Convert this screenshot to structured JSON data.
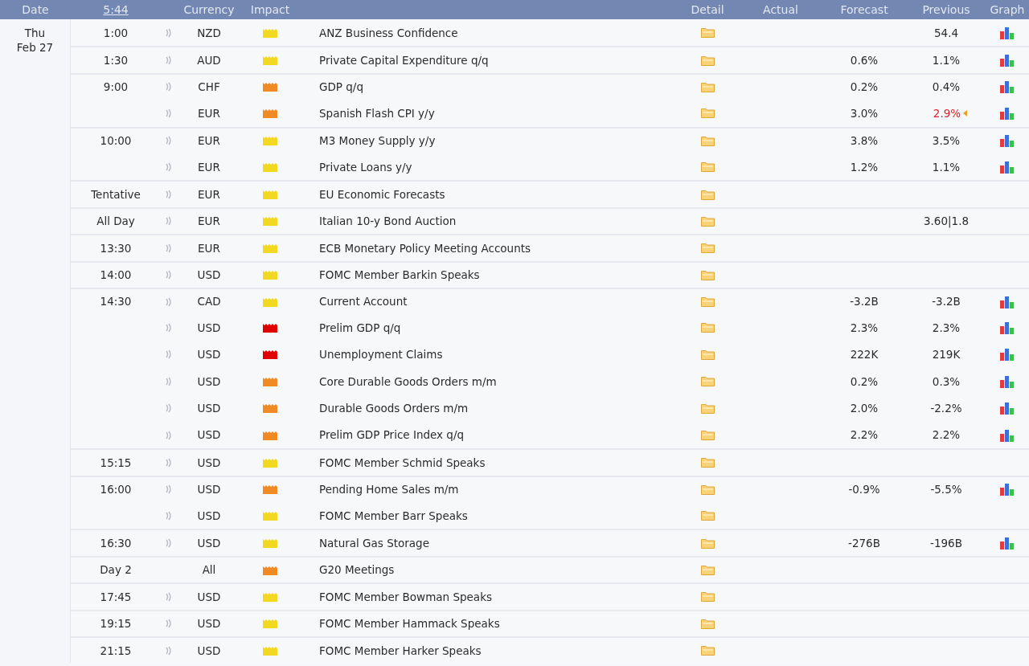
{
  "header": {
    "date": "Date",
    "time": "5:44",
    "currency": "Currency",
    "impact": "Impact",
    "detail": "Detail",
    "actual": "Actual",
    "forecast": "Forecast",
    "previous": "Previous",
    "graph": "Graph"
  },
  "day": {
    "weekday": "Thu",
    "date": "Feb 27"
  },
  "groups": [
    {
      "time": "1:00",
      "rows": [
        {
          "sound": true,
          "currency": "NZD",
          "color": "#f2d820",
          "event": "ANZ Business Confidence",
          "forecast": "",
          "previous": "54.4",
          "revised": false,
          "graph": true
        }
      ]
    },
    {
      "time": "1:30",
      "rows": [
        {
          "sound": true,
          "currency": "AUD",
          "color": "#f2d820",
          "event": "Private Capital Expenditure q/q",
          "forecast": "0.6%",
          "previous": "1.1%",
          "revised": false,
          "graph": true
        }
      ]
    },
    {
      "time": "9:00",
      "rows": [
        {
          "sound": true,
          "currency": "CHF",
          "color": "#f08a24",
          "event": "GDP q/q",
          "forecast": "0.2%",
          "previous": "0.4%",
          "revised": false,
          "graph": true
        },
        {
          "sound": true,
          "currency": "EUR",
          "color": "#f08a24",
          "event": "Spanish Flash CPI y/y",
          "forecast": "3.0%",
          "previous": "2.9%",
          "revised": true,
          "graph": true
        }
      ]
    },
    {
      "time": "10:00",
      "rows": [
        {
          "sound": true,
          "currency": "EUR",
          "color": "#f2d820",
          "event": "M3 Money Supply y/y",
          "forecast": "3.8%",
          "previous": "3.5%",
          "revised": false,
          "graph": true
        },
        {
          "sound": true,
          "currency": "EUR",
          "color": "#f2d820",
          "event": "Private Loans y/y",
          "forecast": "1.2%",
          "previous": "1.1%",
          "revised": false,
          "graph": true
        }
      ]
    },
    {
      "time": "Tentative",
      "rows": [
        {
          "sound": true,
          "currency": "EUR",
          "color": "#f2d820",
          "event": "EU Economic Forecasts",
          "forecast": "",
          "previous": "",
          "revised": false,
          "graph": false
        }
      ]
    },
    {
      "time": "All Day",
      "rows": [
        {
          "sound": true,
          "currency": "EUR",
          "color": "#f2d820",
          "event": "Italian 10-y Bond Auction",
          "forecast": "",
          "previous": "3.60|1.8",
          "revised": false,
          "graph": false
        }
      ]
    },
    {
      "time": "13:30",
      "rows": [
        {
          "sound": true,
          "currency": "EUR",
          "color": "#f2d820",
          "event": "ECB Monetary Policy Meeting Accounts",
          "forecast": "",
          "previous": "",
          "revised": false,
          "graph": false
        }
      ]
    },
    {
      "time": "14:00",
      "rows": [
        {
          "sound": true,
          "currency": "USD",
          "color": "#f2d820",
          "event": "FOMC Member Barkin Speaks",
          "forecast": "",
          "previous": "",
          "revised": false,
          "graph": false
        }
      ]
    },
    {
      "time": "14:30",
      "rows": [
        {
          "sound": true,
          "currency": "CAD",
          "color": "#f2d820",
          "event": "Current Account",
          "forecast": "-3.2B",
          "previous": "-3.2B",
          "revised": false,
          "graph": true
        },
        {
          "sound": true,
          "currency": "USD",
          "color": "#e00000",
          "event": "Prelim GDP q/q",
          "forecast": "2.3%",
          "previous": "2.3%",
          "revised": false,
          "graph": true
        },
        {
          "sound": true,
          "currency": "USD",
          "color": "#e00000",
          "event": "Unemployment Claims",
          "forecast": "222K",
          "previous": "219K",
          "revised": false,
          "graph": true
        },
        {
          "sound": true,
          "currency": "USD",
          "color": "#f08a24",
          "event": "Core Durable Goods Orders m/m",
          "forecast": "0.2%",
          "previous": "0.3%",
          "revised": false,
          "graph": true
        },
        {
          "sound": true,
          "currency": "USD",
          "color": "#f08a24",
          "event": "Durable Goods Orders m/m",
          "forecast": "2.0%",
          "previous": "-2.2%",
          "revised": false,
          "graph": true
        },
        {
          "sound": true,
          "currency": "USD",
          "color": "#f08a24",
          "event": "Prelim GDP Price Index q/q",
          "forecast": "2.2%",
          "previous": "2.2%",
          "revised": false,
          "graph": true
        }
      ]
    },
    {
      "time": "15:15",
      "rows": [
        {
          "sound": true,
          "currency": "USD",
          "color": "#f2d820",
          "event": "FOMC Member Schmid Speaks",
          "forecast": "",
          "previous": "",
          "revised": false,
          "graph": false
        }
      ]
    },
    {
      "time": "16:00",
      "rows": [
        {
          "sound": true,
          "currency": "USD",
          "color": "#f08a24",
          "event": "Pending Home Sales m/m",
          "forecast": "-0.9%",
          "previous": "-5.5%",
          "revised": false,
          "graph": true
        },
        {
          "sound": true,
          "currency": "USD",
          "color": "#f2d820",
          "event": "FOMC Member Barr Speaks",
          "forecast": "",
          "previous": "",
          "revised": false,
          "graph": false
        }
      ]
    },
    {
      "time": "16:30",
      "rows": [
        {
          "sound": true,
          "currency": "USD",
          "color": "#f2d820",
          "event": "Natural Gas Storage",
          "forecast": "-276B",
          "previous": "-196B",
          "revised": false,
          "graph": true
        }
      ]
    },
    {
      "time": "Day 2",
      "rows": [
        {
          "sound": false,
          "currency": "All",
          "color": "#f08a24",
          "event": "G20 Meetings",
          "forecast": "",
          "previous": "",
          "revised": false,
          "graph": false
        }
      ]
    },
    {
      "time": "17:45",
      "rows": [
        {
          "sound": true,
          "currency": "USD",
          "color": "#f2d820",
          "event": "FOMC Member Bowman Speaks",
          "forecast": "",
          "previous": "",
          "revised": false,
          "graph": false
        }
      ]
    },
    {
      "time": "19:15",
      "rows": [
        {
          "sound": true,
          "currency": "USD",
          "color": "#f2d820",
          "event": "FOMC Member Hammack Speaks",
          "forecast": "",
          "previous": "",
          "revised": false,
          "graph": false
        }
      ]
    },
    {
      "time": "21:15",
      "rows": [
        {
          "sound": true,
          "currency": "USD",
          "color": "#f2d820",
          "event": "FOMC Member Harker Speaks",
          "forecast": "",
          "previous": "",
          "revised": false,
          "graph": false
        }
      ]
    }
  ]
}
